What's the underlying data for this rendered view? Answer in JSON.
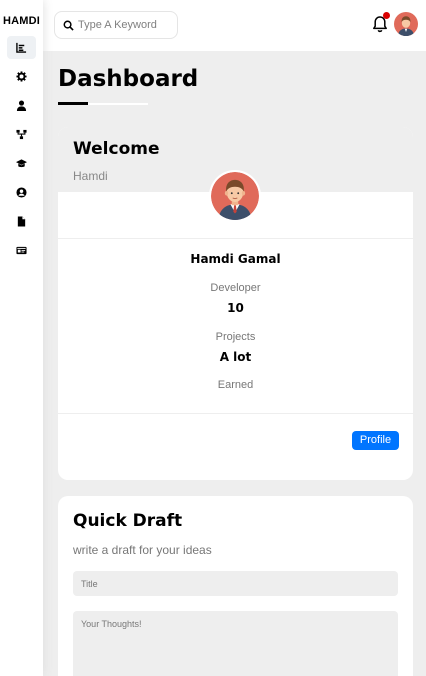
{
  "brand": "HAMDI",
  "sidebar": {
    "items": [
      {
        "icon": "chart-icon",
        "active": true
      },
      {
        "icon": "gear-icon"
      },
      {
        "icon": "user-icon"
      },
      {
        "icon": "projects-icon"
      },
      {
        "icon": "graduation-cap-icon"
      },
      {
        "icon": "user-circle-icon"
      },
      {
        "icon": "file-icon"
      },
      {
        "icon": "id-card-icon"
      }
    ]
  },
  "header": {
    "search_placeholder": "Type A Keyword",
    "notification_dot_color": "#d90000"
  },
  "page": {
    "title": "Dashboard"
  },
  "welcome": {
    "title": "Welcome",
    "subtitle": "Hamdi",
    "name": "Hamdi Gamal",
    "role_label": "Developer",
    "projects_value": "10",
    "projects_label": "Projects",
    "earned_value": "A lot",
    "earned_label": "Earned",
    "profile_button": "Profile"
  },
  "draft": {
    "title": "Quick Draft",
    "subtitle": "write a draft for your ideas",
    "title_placeholder": "Title",
    "thoughts_placeholder": "Your Thoughts!"
  },
  "colors": {
    "accent": "#0075ff",
    "background": "#eeeeee",
    "avatar_bg": "#e06a5a"
  }
}
